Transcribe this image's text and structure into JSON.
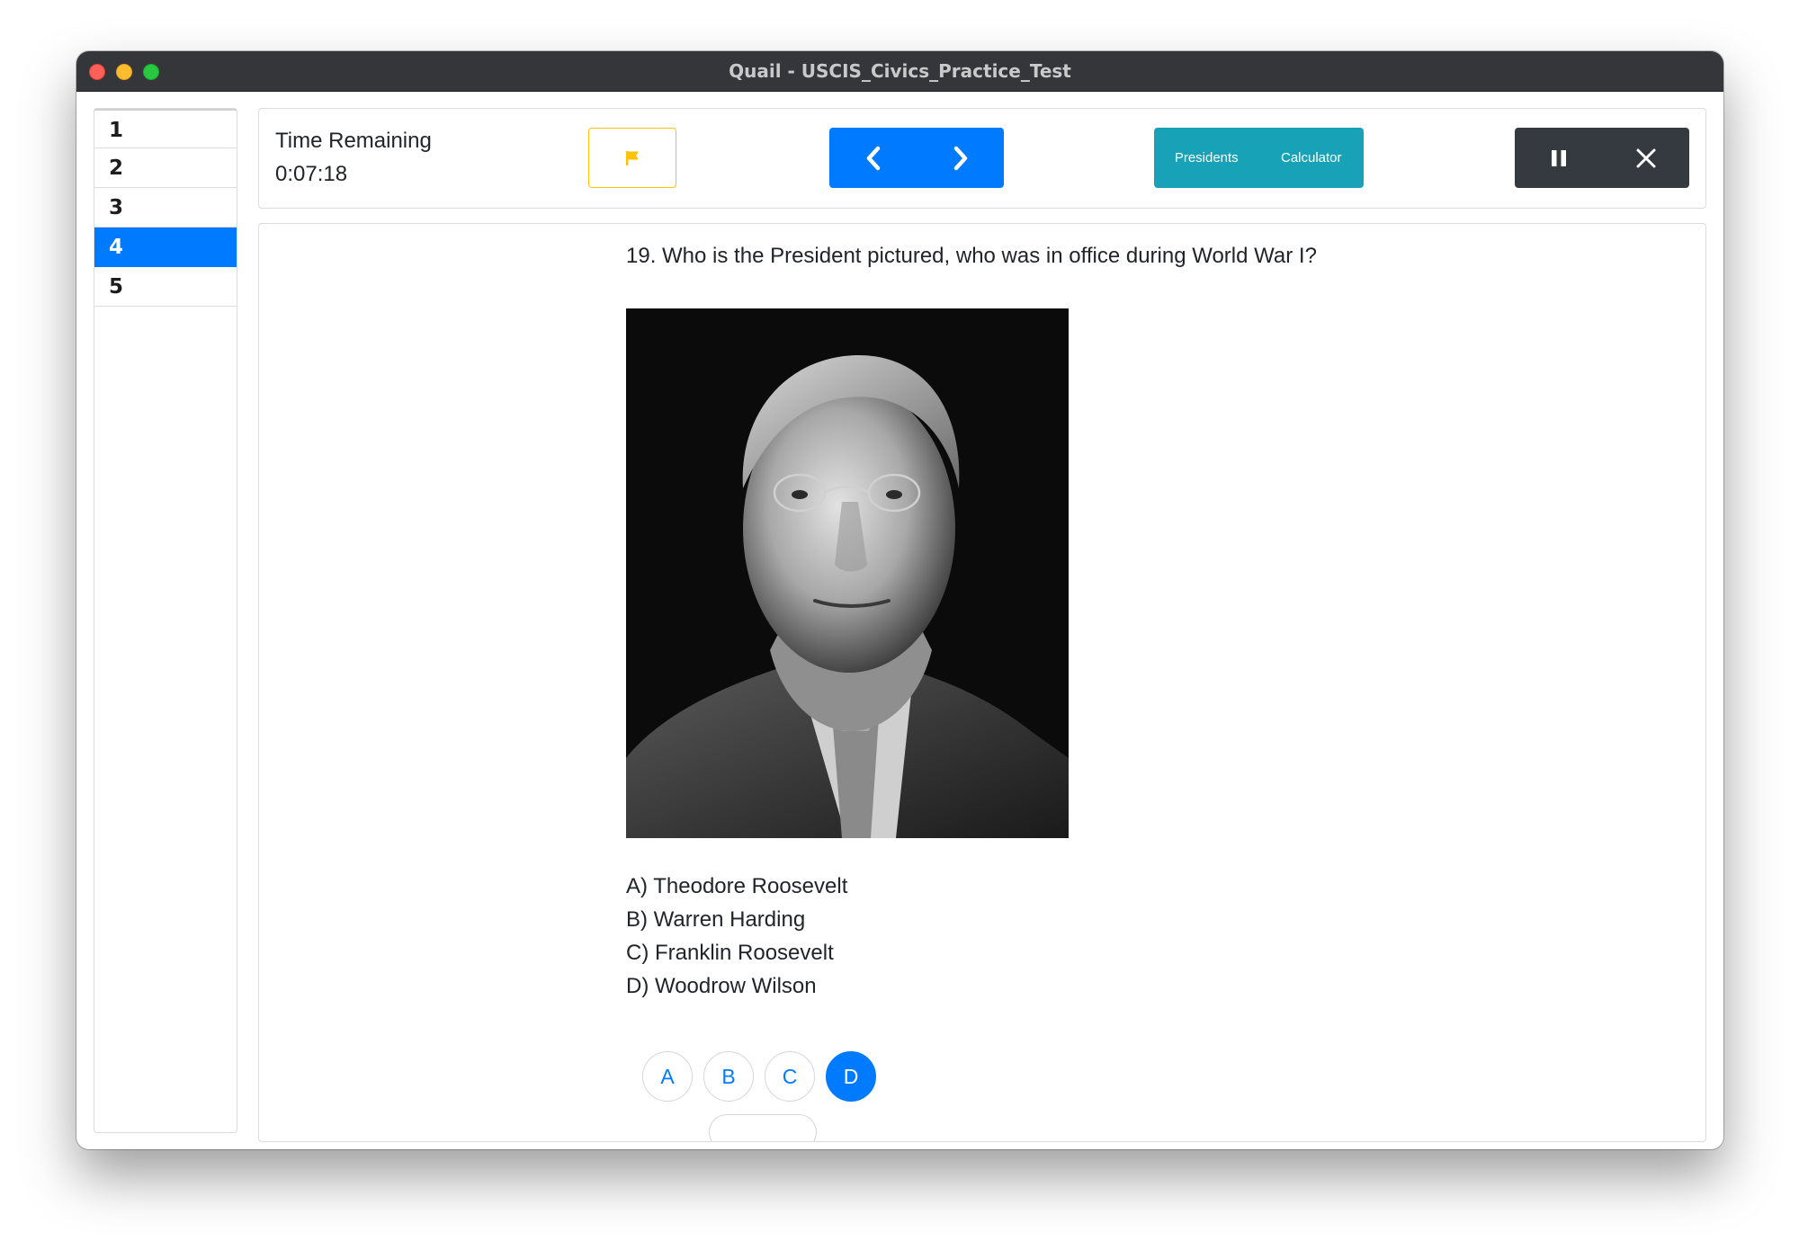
{
  "window": {
    "title": "Quail - USCIS_Civics_Practice_Test"
  },
  "question_nav": {
    "items": [
      "1",
      "2",
      "3",
      "4",
      "5"
    ],
    "active_index": 3
  },
  "toolbar": {
    "timer_label": "Time Remaining",
    "timer_value": "0:07:18",
    "presidents_label": "Presidents",
    "calculator_label": "Calculator"
  },
  "question": {
    "text": "19. Who is the President pictured, who was in office during World War I?",
    "options": [
      "A) Theodore Roosevelt",
      "B) Warren Harding",
      "C) Franklin Roosevelt",
      "D) Woodrow Wilson"
    ],
    "answer_buttons": [
      "A",
      "B",
      "C",
      "D"
    ],
    "selected_answer": "D"
  },
  "colors": {
    "primary": "#007bff",
    "info": "#17a2b8",
    "dark": "#343a40",
    "warning": "#ffc107",
    "titlebar": "#34363a"
  },
  "icons": {
    "flag": "flag-icon",
    "previous": "chevron-left-icon",
    "next": "chevron-right-icon",
    "pause": "pause-icon",
    "close": "close-icon"
  }
}
